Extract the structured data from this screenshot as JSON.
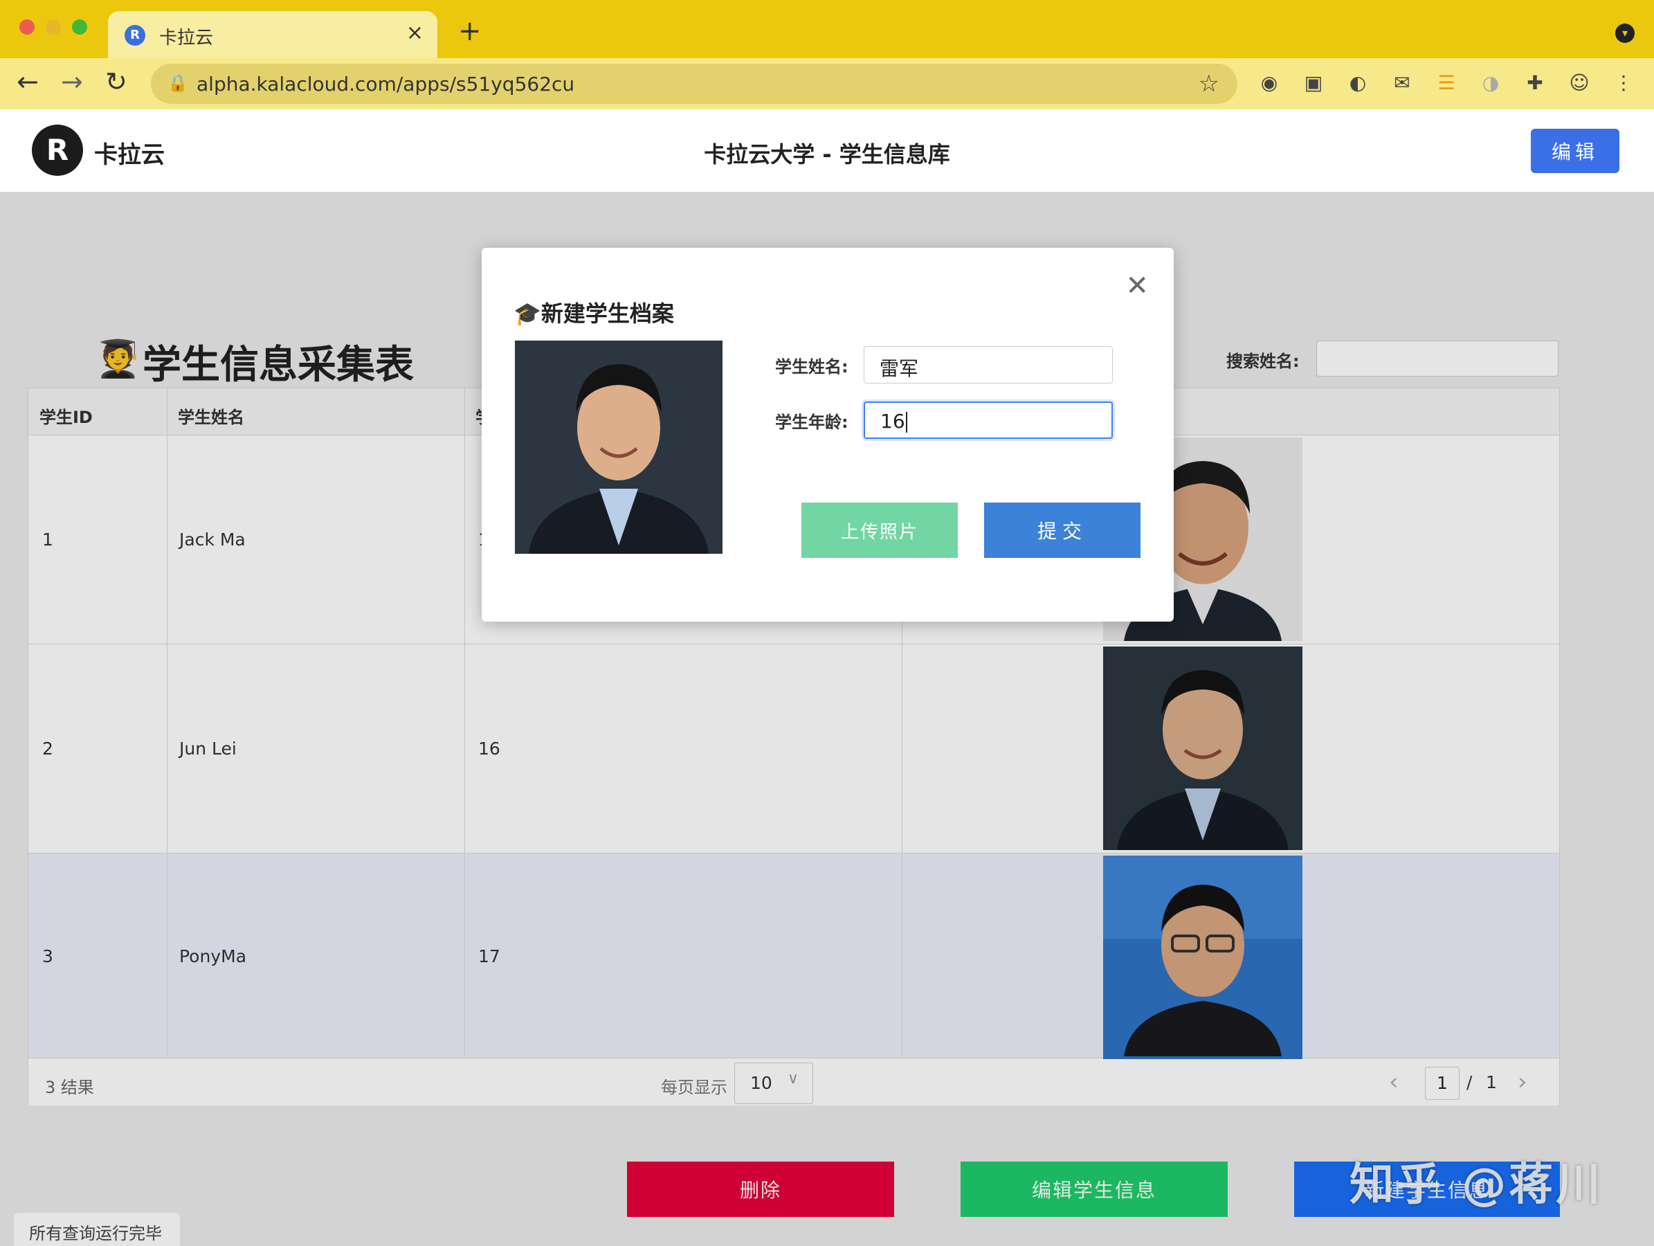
{
  "browser": {
    "tab_title": "卡拉云",
    "tab_close": "×",
    "new_tab": "+",
    "url": "alpha.kalacloud.com/apps/s51yq562cu",
    "icons": [
      "back-icon",
      "forward-icon",
      "reload-icon",
      "lock-icon",
      "star-icon",
      "extension-icon",
      "profile-icon",
      "menu-icon"
    ]
  },
  "app": {
    "logo_letter": "R",
    "name": "卡拉云",
    "title": "卡拉云大学 - 学生信息库",
    "edit_label": "编辑"
  },
  "page": {
    "form_title": "学生信息采集表",
    "search_label": "搜索姓名:",
    "search_value": ""
  },
  "table": {
    "columns": [
      "学生ID",
      "学生姓名",
      "学"
    ],
    "rows": [
      {
        "id": "1",
        "name": "Jack Ma",
        "age": "1"
      },
      {
        "id": "2",
        "name": "Jun Lei",
        "age": "16"
      },
      {
        "id": "3",
        "name": "PonyMa",
        "age": "17"
      }
    ],
    "footer": {
      "count": "3 结果",
      "per_page_label": "每页显示",
      "per_page_value": "10",
      "page_current": "1",
      "page_sep": "/",
      "page_total": "1"
    }
  },
  "buttons": {
    "delete": "删除",
    "edit_info": "编辑学生信息",
    "new_student": "新建学生信息"
  },
  "status_bar": "所有查询运行完毕",
  "watermark": "知乎 @蒋川",
  "modal": {
    "title": "新建学生档案",
    "name_label": "学生姓名:",
    "name_value": "雷军",
    "age_label": "学生年龄:",
    "age_value": "16",
    "upload_label": "上传照片",
    "submit_label": "提交"
  },
  "colors": {
    "chrome": "#ebc80e",
    "primary": "#3b6fe5",
    "delete": "#e6003b",
    "success": "#1fcc6c",
    "blue": "#1a6ff5"
  }
}
